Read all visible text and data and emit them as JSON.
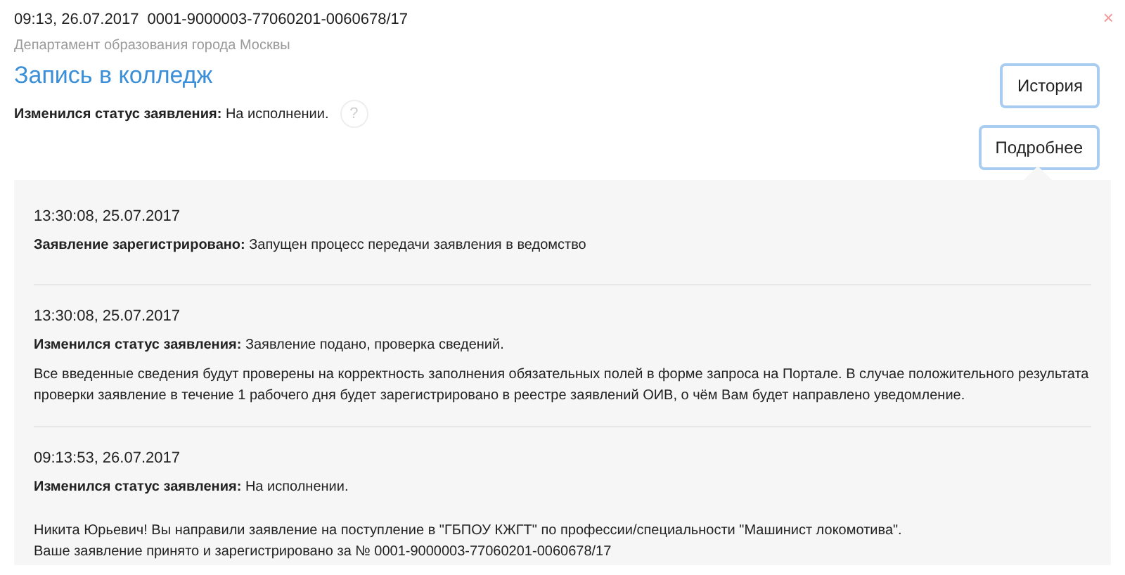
{
  "header": {
    "timestamp": "09:13, 26.07.2017",
    "number": "0001-9000003-77060201-0060678/17",
    "department": "Департамент образования города Москвы",
    "title": "Запись в колледж",
    "status_label": "Изменился статус заявления:",
    "status_text": "На исполнении.",
    "help": "?",
    "close": "×"
  },
  "buttons": [
    {
      "label": "История"
    },
    {
      "label": "Подробнее"
    }
  ],
  "history": [
    {
      "time": "13:30:08, 25.07.2017",
      "status_label": "Заявление зарегистрировано:",
      "status_text": "Запущен процесс передачи заявления в ведомство"
    },
    {
      "time": "13:30:08, 25.07.2017",
      "status_label": "Изменился статус заявления:",
      "status_text": "Заявление подано, проверка сведений.",
      "notes": [
        "Все введенные сведения будут проверены на корректность заполнения обязательных полей в форме запроса на Портале. В случае положительного результата проверки заявление в течение 1 рабочего дня будет зарегистрировано в реестре заявлений ОИВ, о чём Вам будет направлено уведомление."
      ]
    },
    {
      "time": "09:13:53, 26.07.2017",
      "status_label": "Изменился статус заявления:",
      "status_text": "На исполнении.",
      "notes": [
        "Никита Юрьевич! Вы направили заявление на поступление в \"ГБПОУ КЖГТ\" по профессии/специальности \"Машинист локомотива\".",
        "Ваше заявление принято и зарегистрировано за № 0001-9000003-77060201-0060678/17"
      ]
    }
  ]
}
